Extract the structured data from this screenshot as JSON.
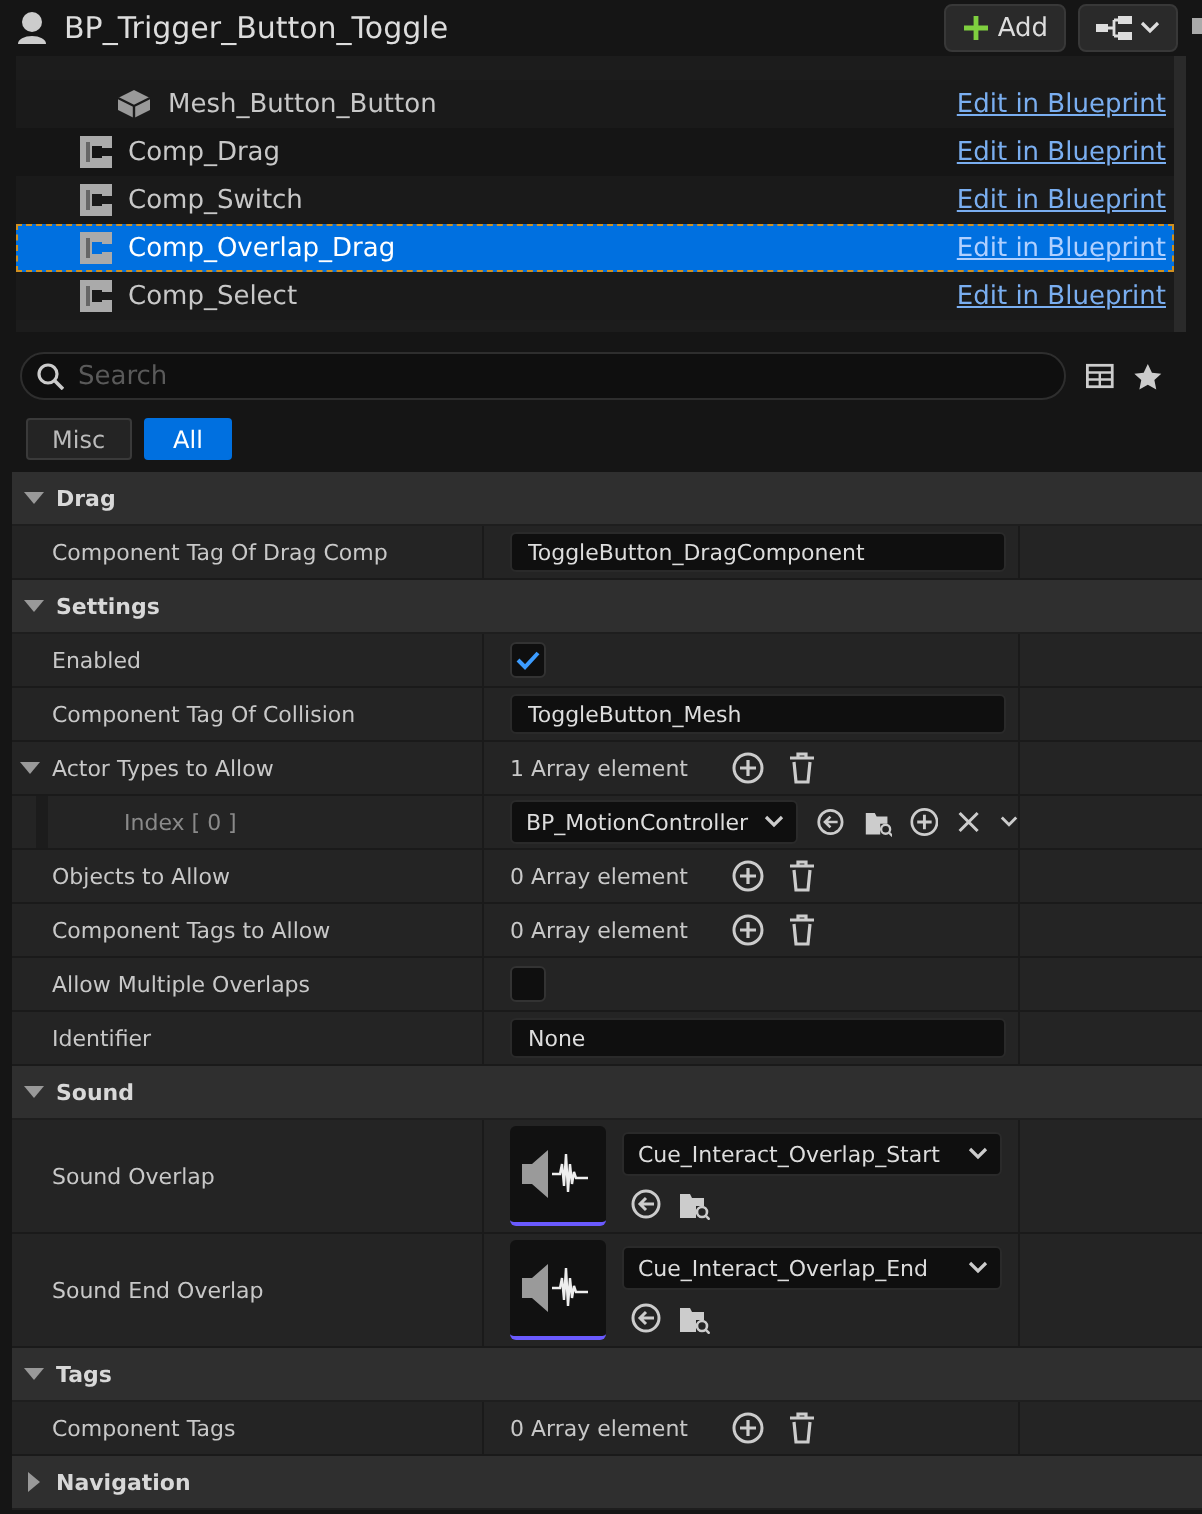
{
  "window": {
    "title": "BP_Trigger_Button_Toggle"
  },
  "toolbar": {
    "add_button": "Add"
  },
  "components": [
    {
      "name": "Mesh_Button_Button",
      "kind": "mesh",
      "selected": false,
      "link": "Edit in Blueprint"
    },
    {
      "name": "Comp_Drag",
      "kind": "script",
      "selected": false,
      "link": "Edit in Blueprint"
    },
    {
      "name": "Comp_Switch",
      "kind": "script",
      "selected": false,
      "link": "Edit in Blueprint"
    },
    {
      "name": "Comp_Overlap_Drag",
      "kind": "script",
      "selected": true,
      "link": "Edit in Blueprint"
    },
    {
      "name": "Comp_Select",
      "kind": "script",
      "selected": false,
      "link": "Edit in Blueprint"
    }
  ],
  "search": {
    "placeholder": "Search"
  },
  "filters": [
    {
      "label": "Misc",
      "selected": false
    },
    {
      "label": "All",
      "selected": true
    }
  ],
  "categories": [
    {
      "name": "Drag",
      "expanded": true,
      "properties": [
        {
          "label": "Component Tag Of Drag Comp",
          "kind": "text",
          "value": "ToggleButton_DragComponent"
        }
      ]
    },
    {
      "name": "Settings",
      "expanded": true,
      "properties": [
        {
          "label": "Enabled",
          "kind": "checkbox",
          "checked": true
        },
        {
          "label": "Component Tag Of Collision",
          "kind": "text",
          "value": "ToggleButton_Mesh"
        },
        {
          "label": "Actor Types to Allow",
          "kind": "array",
          "value": "1 Array element",
          "expanded": true,
          "children": [
            {
              "label": "Index [ 0 ]",
              "kind": "class",
              "value": "BP_MotionController"
            }
          ]
        },
        {
          "label": "Objects to Allow",
          "kind": "array",
          "value": "0 Array element"
        },
        {
          "label": "Component Tags to Allow",
          "kind": "array",
          "value": "0 Array element"
        },
        {
          "label": "Allow Multiple Overlaps",
          "kind": "checkbox",
          "checked": false
        },
        {
          "label": "Identifier",
          "kind": "text",
          "value": "None"
        }
      ]
    },
    {
      "name": "Sound",
      "expanded": true,
      "properties": [
        {
          "label": "Sound Overlap",
          "kind": "sound",
          "value": "Cue_Interact_Overlap_Start"
        },
        {
          "label": "Sound End Overlap",
          "kind": "sound",
          "value": "Cue_Interact_Overlap_End"
        }
      ]
    },
    {
      "name": "Tags",
      "expanded": true,
      "properties": [
        {
          "label": "Component Tags",
          "kind": "array",
          "value": "0 Array element"
        }
      ]
    },
    {
      "name": "Navigation",
      "expanded": false
    }
  ]
}
